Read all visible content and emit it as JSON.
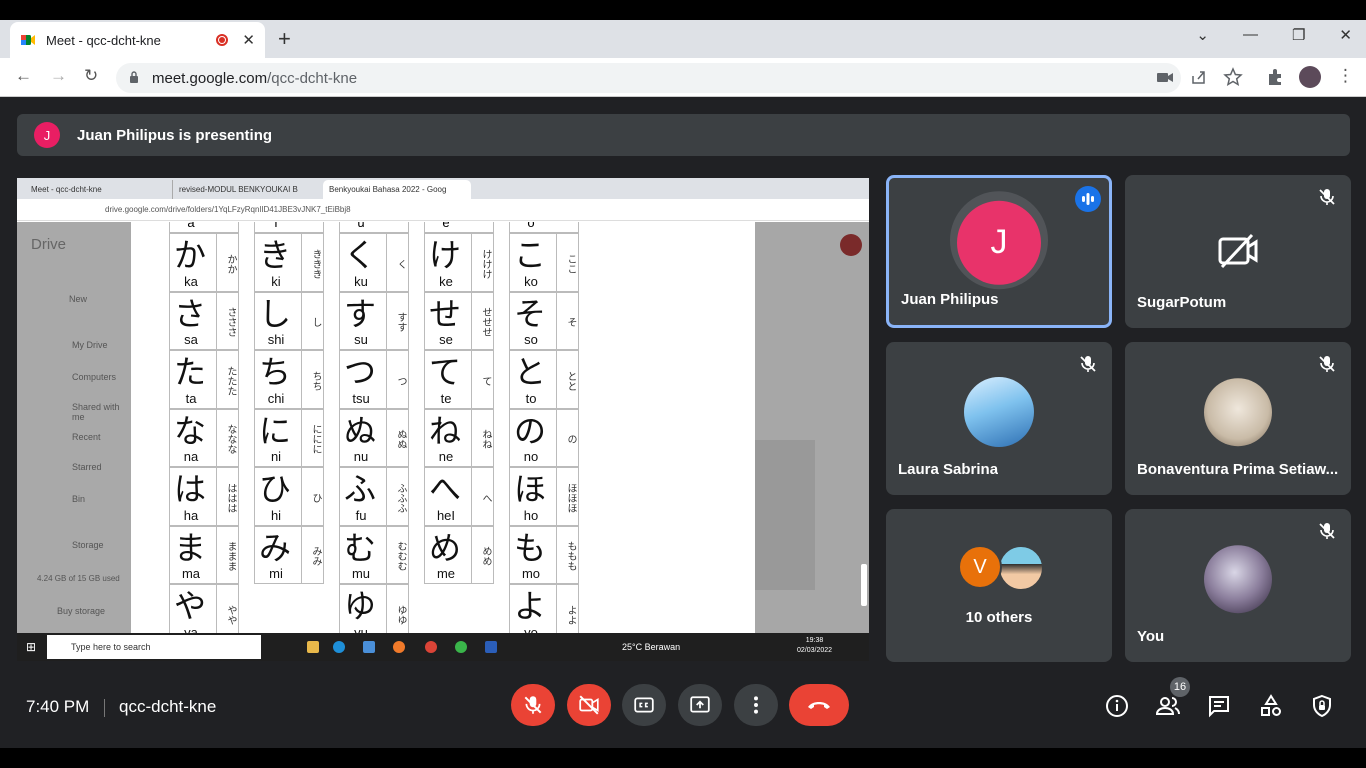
{
  "browser": {
    "tab_title": "Meet - qcc-dcht-kne",
    "url_domain": "meet.google.com",
    "url_path": "/qcc-dcht-kne"
  },
  "banner": {
    "avatar_letter": "J",
    "text": "Juan Philipus is presenting"
  },
  "shared_screen": {
    "tabs": [
      "Meet - qcc-dcht-kne",
      "revised-MODUL BENKYOUKAI B",
      "Benkyoukai Bahasa 2022 - Goog"
    ],
    "url": "drive.google.com/drive/folders/1YqLFzyRqnlID41JBE3vJNK7_tEiBbj8",
    "drive_logo": "Drive",
    "drive_sidebar": [
      "New",
      "My Drive",
      "Computers",
      "Shared with me",
      "Recent",
      "Starred",
      "Bin",
      "Storage",
      "4.24 GB of 15 GB used",
      "Buy storage"
    ],
    "kana_header": [
      "a",
      "i",
      "u",
      "e",
      "o"
    ],
    "kana_rows": [
      [
        [
          "か",
          "ka",
          "かか"
        ],
        [
          "き",
          "ki",
          "ききき"
        ],
        [
          "く",
          "ku",
          "く"
        ],
        [
          "け",
          "ke",
          "けけけ"
        ],
        [
          "こ",
          "ko",
          "ここ"
        ]
      ],
      [
        [
          "さ",
          "sa",
          "さささ"
        ],
        [
          "し",
          "shi",
          "し"
        ],
        [
          "す",
          "su",
          "すす"
        ],
        [
          "せ",
          "se",
          "せせせ"
        ],
        [
          "そ",
          "so",
          "そ"
        ]
      ],
      [
        [
          "た",
          "ta",
          "たたた"
        ],
        [
          "ち",
          "chi",
          "ちち"
        ],
        [
          "つ",
          "tsu",
          "つ"
        ],
        [
          "て",
          "te",
          "て"
        ],
        [
          "と",
          "to",
          "とと"
        ]
      ],
      [
        [
          "な",
          "na",
          "ななな"
        ],
        [
          "に",
          "ni",
          "ににに"
        ],
        [
          "ぬ",
          "nu",
          "ぬぬ"
        ],
        [
          "ね",
          "ne",
          "ねね"
        ],
        [
          "の",
          "no",
          "の"
        ]
      ],
      [
        [
          "は",
          "ha",
          "ははは"
        ],
        [
          "ひ",
          "hi",
          "ひ"
        ],
        [
          "ふ",
          "fu",
          "ふふふ"
        ],
        [
          "へ",
          "heI",
          "へ"
        ],
        [
          "ほ",
          "ho",
          "ほほほ"
        ]
      ],
      [
        [
          "ま",
          "ma",
          "ままま"
        ],
        [
          "み",
          "mi",
          "みみ"
        ],
        [
          "む",
          "mu",
          "むむむ"
        ],
        [
          "め",
          "me",
          "めめ"
        ],
        [
          "も",
          "mo",
          "ももも"
        ]
      ],
      [
        [
          "や",
          "ya",
          "やや"
        ],
        [
          "",
          "",
          ""
        ],
        [
          "ゆ",
          "yu",
          "ゆゆ"
        ],
        [
          "",
          "",
          ""
        ],
        [
          "よ",
          "yo",
          "よよ"
        ]
      ]
    ],
    "taskbar": {
      "search_placeholder": "Type here to search",
      "weather": "25°C  Berawan",
      "clock_time": "19:38",
      "clock_date": "02/03/2022"
    }
  },
  "participants": [
    {
      "name": "Juan Philipus",
      "avatar_letter": "J",
      "speaking": true
    },
    {
      "name": "SugarPotum",
      "muted": true,
      "camera_off": true
    },
    {
      "name": "Laura Sabrina",
      "muted": true
    },
    {
      "name": "Bonaventura Prima Setiaw...",
      "muted": true
    },
    {
      "name": "You",
      "muted": true
    }
  ],
  "others": {
    "avatar_letter": "V",
    "label": "10 others"
  },
  "bottom_bar": {
    "time": "7:40 PM",
    "meeting_code": "qcc-dcht-kne",
    "participant_count": "16"
  },
  "colors": {
    "meet_bg": "#202124",
    "tile_bg": "#3c4043",
    "red": "#ea4335",
    "speaking_border": "#8ab4f8",
    "avatar_pink": "#e8336a"
  }
}
